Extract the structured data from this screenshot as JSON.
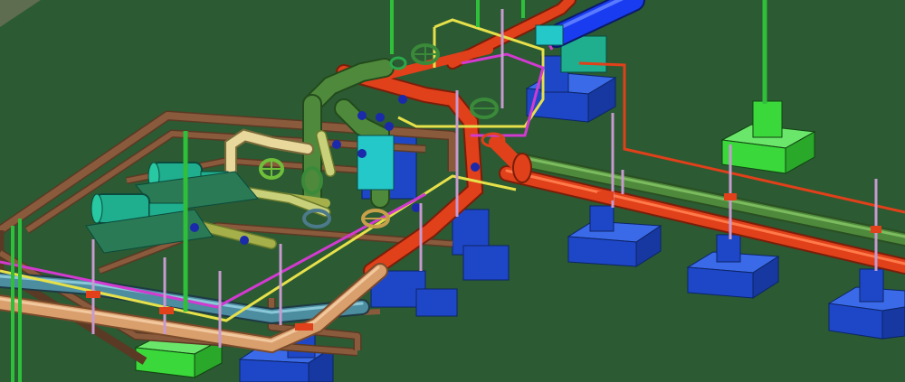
{
  "viewport": {
    "background_color": "#2b5a33",
    "corner_background_color": "#5e6c4f"
  },
  "colors": {
    "concrete_block": "#1e47c8",
    "concrete_edge": "#0d2466",
    "pump_skid_frame": "#8a5a3c",
    "steel_column": "#2fbf3a",
    "green_footing": "#3bd83b",
    "main_pipe_green": "#4f8a3c",
    "main_pipe_red": "#e0401a",
    "main_pipe_tan": "#d9a06e",
    "main_pipe_teal": "#4c8da0",
    "main_pipe_blue": "#1a3cf0",
    "pump_body": "#1fae8e",
    "valve_handwheel": "#6fbf3a",
    "yellow_line": "#e6e04a",
    "magenta_line": "#d23ad0",
    "pipe_support": "#c79ad0",
    "olive_pipe": "#a6b04a",
    "cream_pipe": "#e8d89c"
  }
}
